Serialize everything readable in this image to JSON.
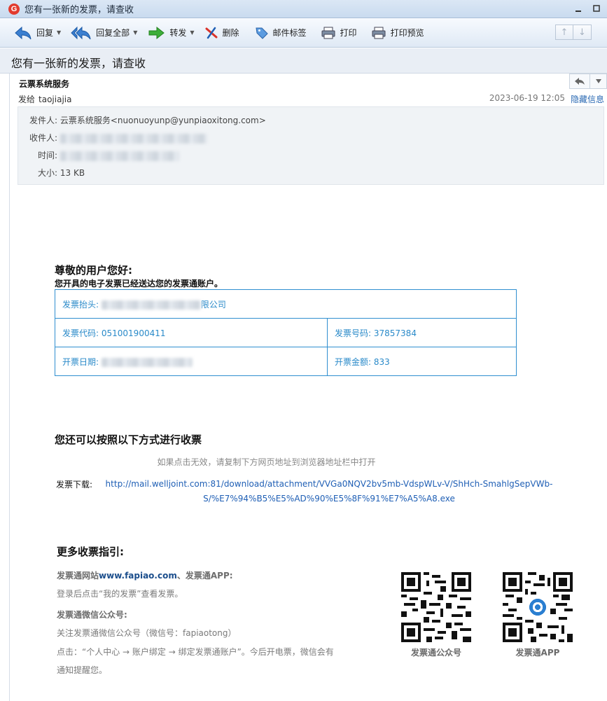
{
  "window": {
    "title": "您有一张新的发票，请查收",
    "app_icon_glyph": "G"
  },
  "toolbar": {
    "reply": "回复",
    "reply_all": "回复全部",
    "forward": "转发",
    "delete": "删除",
    "mail_tag": "邮件标签",
    "print": "打印",
    "print_preview": "打印预览"
  },
  "message": {
    "subject": "您有一张新的发票，请查收",
    "sender_name": "云票系统服务",
    "sent_to_label": "发给",
    "sent_to": "taojiajia",
    "time": "2023-06-19 12:05",
    "hide_info": "隐藏信息",
    "details": {
      "from_label": "发件人:",
      "from_value": "云票系统服务<nuonuoyunp@yunpiaoxitong.com>",
      "to_label": "收件人:",
      "time_label": "时间:",
      "size_label": "大小:",
      "size_value": "13 KB"
    }
  },
  "body": {
    "greeting": "尊敬的用户您好:",
    "intro": "您开具的电子发票已经送达您的发票通账户。",
    "invoice": {
      "title_label": "发票抬头:",
      "title_suffix": "限公司",
      "code_label": "发票代码:",
      "code_value": "051001900411",
      "number_label": "发票号码:",
      "number_value": "37857384",
      "date_label": "开票日期:",
      "amount_label": "开票金额:",
      "amount_value": "833"
    },
    "section2_title": "您还可以按照以下方式进行收票",
    "section2_hint": "如果点击无效，请复制下方网页地址到浏览器地址栏中打开",
    "download_label": "发票下载:",
    "download_link": "http://mail.welljoint.com:81/download/attachment/VVGa0NQV2bv5mb-VdspWLv-V/ShHch-SmahlgSepVWb-S/%E7%94%B5%E5%AD%90%E5%8F%91%E7%A5%A8.exe",
    "more_title": "更多收票指引:",
    "guide": {
      "site_prefix": "发票通网站",
      "site_domain": "www.fapiao.com",
      "site_suffix": "、发票通APP:",
      "site_desc": "登录后点击“我的发票”查看发票。",
      "wechat_title": "发票通微信公众号:",
      "wechat_desc": "关注发票通微信公众号（微信号：fapiaotong）",
      "steps_line1": "点击：“个人中心 → 账户绑定 → 绑定发票通账户”。今后开电票，微信会有",
      "steps_line2": "通知提醒您。"
    },
    "qr1_label": "发票通公众号",
    "qr2_label": "发票通APP"
  },
  "icons": {
    "reply": "reply-arrow-icon",
    "reply_all": "reply-all-icon",
    "forward": "forward-arrow-icon",
    "delete": "delete-x-icon",
    "tag": "tag-icon",
    "print": "printer-icon",
    "print_preview": "print-preview-icon"
  },
  "colors": {
    "link": "#1f5fb5",
    "invoice_table": "#2f8fd0",
    "app_icon": "#e23b2e"
  }
}
